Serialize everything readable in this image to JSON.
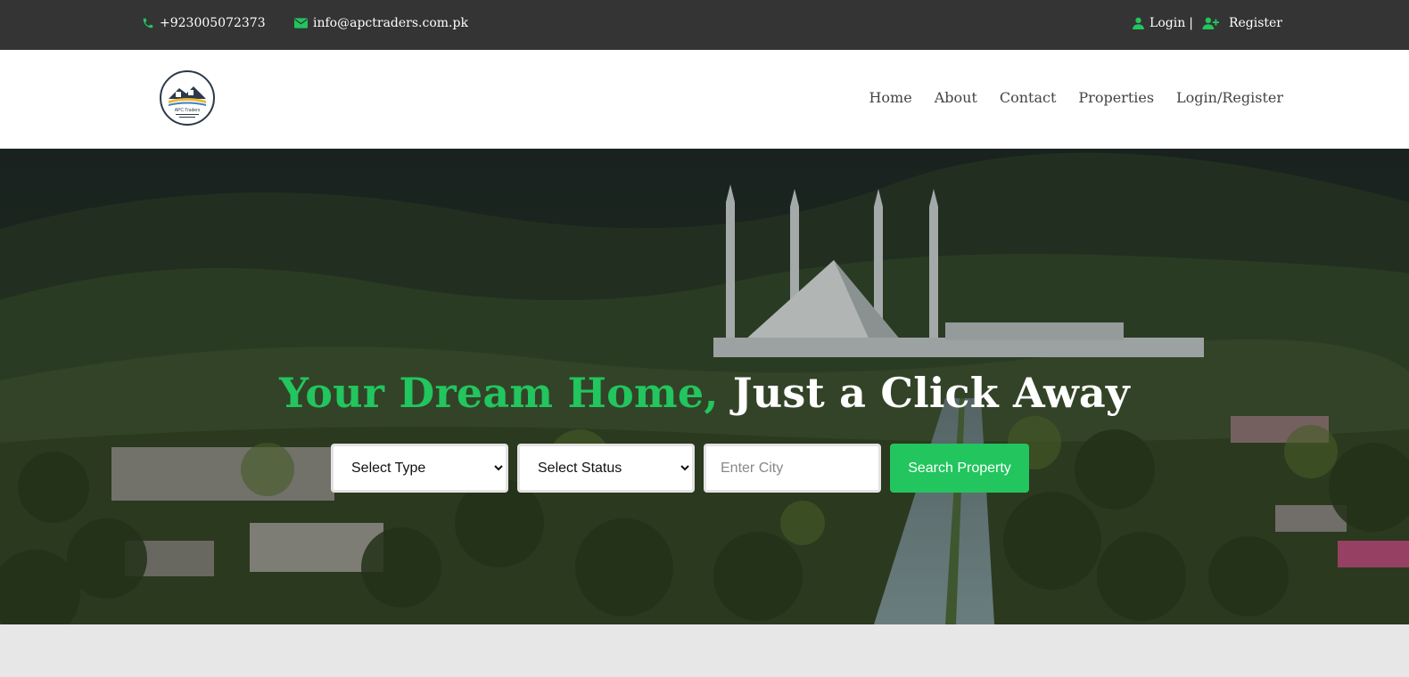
{
  "topbar": {
    "phone": "+923005072373",
    "email": "info@apctraders.com.pk",
    "login": "Login",
    "separator": "|",
    "register": "Register",
    "icon_color": "#22c55e"
  },
  "header": {
    "logo_text": "APC Traders",
    "nav": [
      {
        "label": "Home"
      },
      {
        "label": "About"
      },
      {
        "label": "Contact"
      },
      {
        "label": "Properties"
      },
      {
        "label": "Login/Register"
      }
    ]
  },
  "hero": {
    "title_accent": "Your Dream Home,",
    "title_rest": "Just a Click Away",
    "type_select": "Select Type",
    "status_select": "Select Status",
    "city_placeholder": "Enter City",
    "search_button": "Search Property",
    "accent_color": "#22c55e"
  }
}
